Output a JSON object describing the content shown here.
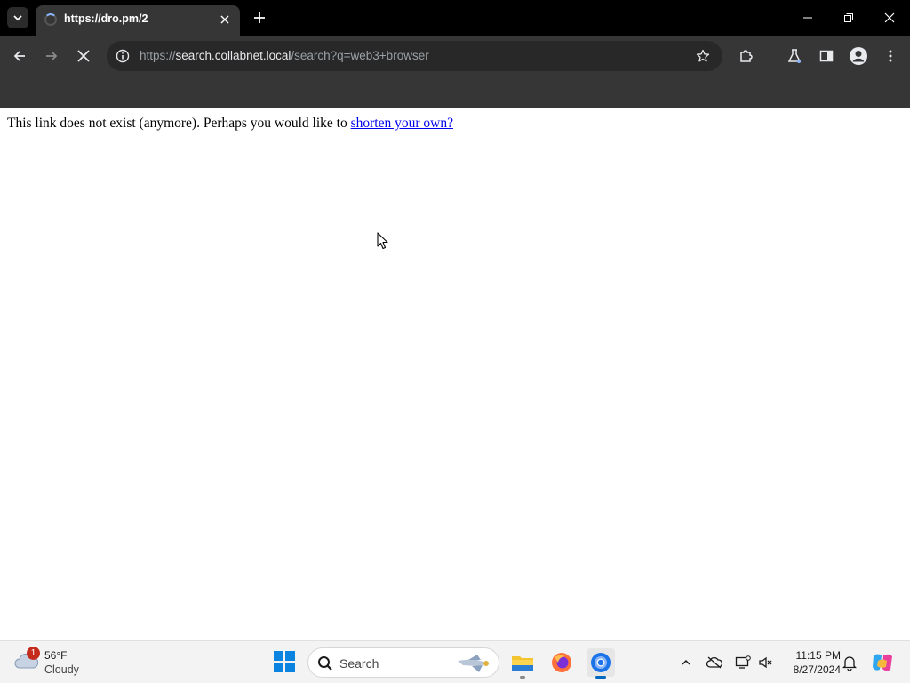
{
  "browser": {
    "tab": {
      "title": "https://dro.pm/2"
    },
    "omnibox": {
      "url_scheme": "https://",
      "url_host": "search.collabnet.local",
      "url_path": "/search?q=web3+browser"
    }
  },
  "page": {
    "message": "This link does not exist (anymore). Perhaps you would like to ",
    "link_text": "shorten your own?"
  },
  "taskbar": {
    "weather": {
      "badge": "1",
      "temp": "56°F",
      "condition": "Cloudy"
    },
    "search_label": "Search",
    "clock": {
      "time": "11:15 PM",
      "date": "8/27/2024"
    }
  },
  "colors": {
    "link": "#0000ee",
    "chrome_dark": "#363636",
    "accent": "#0067c0"
  }
}
